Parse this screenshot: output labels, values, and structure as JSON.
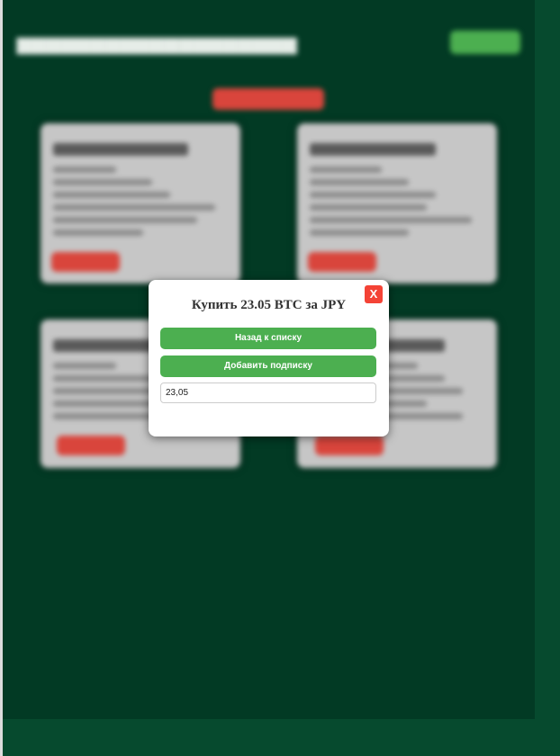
{
  "background": {
    "page_color": "#023a24",
    "outer_color": "#064a2e",
    "accent_green": "#4caf50",
    "accent_red": "#d9453c"
  },
  "modal": {
    "title": "Купить 23.05 BTC за JPY",
    "close_label": "X",
    "back_label": "Назад к списку",
    "subscribe_label": "Добавить подписку",
    "amount_value": "23,05"
  }
}
